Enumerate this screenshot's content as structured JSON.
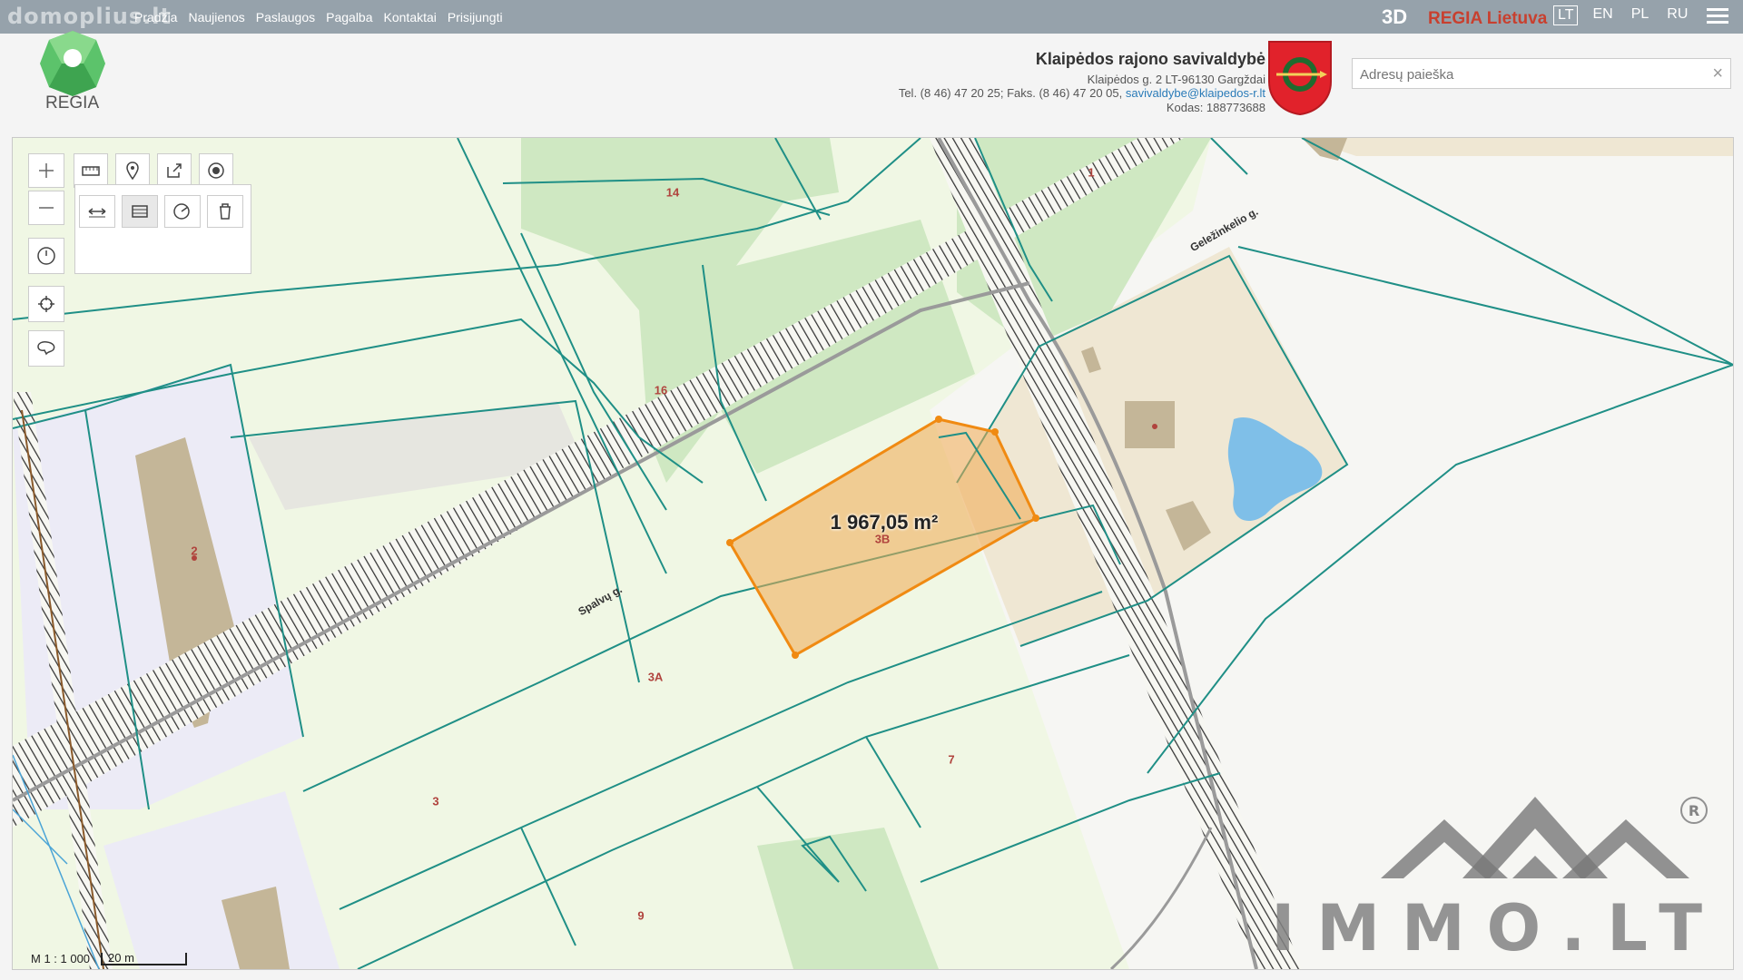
{
  "watermark_top": "domoplius.lt",
  "nav": [
    "Pradžia",
    "Naujienos",
    "Paslaugos",
    "Pagalba",
    "Kontaktai",
    "Prisijungti"
  ],
  "btn_3d": "3D",
  "regia_lietuva": "REGIA Lietuva",
  "languages": [
    "LT",
    "EN",
    "PL",
    "RU"
  ],
  "active_language": "LT",
  "logo_text": "REGIA",
  "municipality": {
    "name": "Klaipėdos rajono savivaldybė",
    "address": "Klaipėdos g. 2 LT-96130 Gargždai",
    "phone": "Tel. (8 46) 47 20 25; Faks. (8 46) 47 20 05,",
    "email": "savivaldybe@klaipedos-r.lt",
    "code": "Kodas: 188773688"
  },
  "search": {
    "placeholder": "Adresų paieška",
    "clear": "×"
  },
  "map": {
    "parcels": [
      "1",
      "14",
      "16",
      "2",
      "3B",
      "3A",
      "3",
      "7",
      "9"
    ],
    "streets": [
      "Geležinkelio g.",
      "Spalvų g."
    ],
    "selected_area": "1 967,05 m²",
    "scale_ratio": "M 1 : 1 000",
    "scale_bar": "20 m"
  },
  "watermark_bottom": "IMMO.LT",
  "colors": {
    "topbar": "#96a2ab",
    "selection": "#f08a12",
    "parcel_line": "#1f8f86",
    "regia_red": "#c8402f"
  }
}
